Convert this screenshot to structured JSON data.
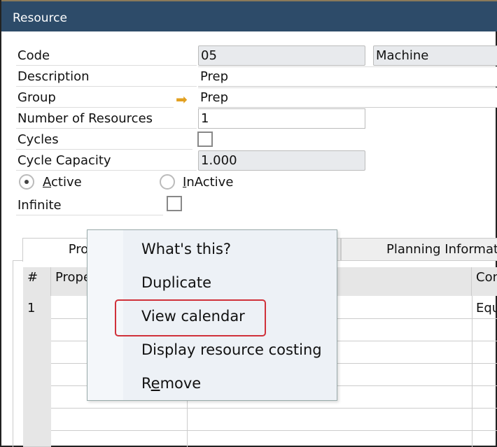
{
  "window": {
    "title": "Resource"
  },
  "form": {
    "code": {
      "label": "Code",
      "value": "05",
      "type": "Machine"
    },
    "description": {
      "label": "Description",
      "value": "Prep"
    },
    "group": {
      "label": "Group",
      "value": "Prep",
      "icon": "link-arrow-icon"
    },
    "number_of_resources": {
      "label": "Number of Resources",
      "value": "1"
    },
    "cycles": {
      "label": "Cycles",
      "checked": false
    },
    "cycle_capacity": {
      "label": "Cycle Capacity",
      "value": "1.000"
    },
    "status": {
      "active_label": "Active",
      "inactive_label": "InActive",
      "selected": "Active"
    },
    "infinite": {
      "label": "Infinite",
      "checked": false
    }
  },
  "tabs": [
    {
      "label": "Pro"
    },
    {
      "label": ""
    },
    {
      "label": "Planning Informat"
    }
  ],
  "grid": {
    "headers": [
      "#",
      "Prope",
      "",
      "Con"
    ],
    "rows": [
      [
        "1",
        "",
        "",
        "Equ"
      ]
    ]
  },
  "context_menu": {
    "items": [
      {
        "label": "What's this?"
      },
      {
        "label": "Duplicate"
      },
      {
        "label": "View calendar",
        "highlighted": true
      },
      {
        "label": "Display resource costing"
      },
      {
        "label": "Remove",
        "accel": "e"
      }
    ],
    "highlight_color": "#d0313a"
  }
}
